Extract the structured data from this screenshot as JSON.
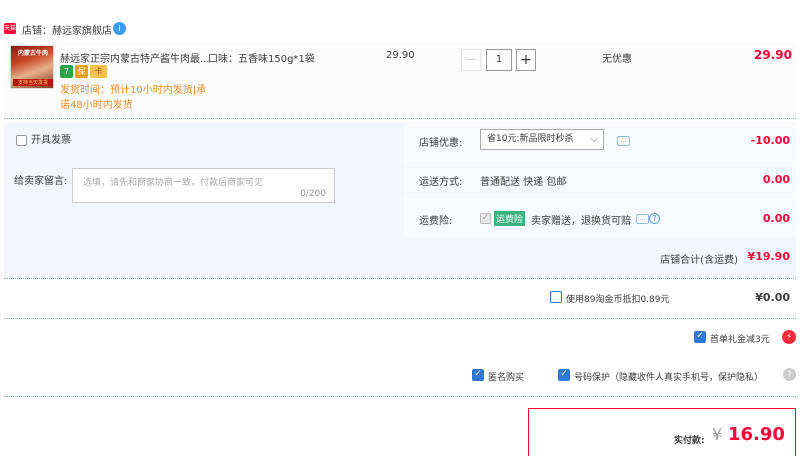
{
  "shop": {
    "icon_text": "天猫",
    "label": "店铺：赫远家旗舰店",
    "ww_icon": "i"
  },
  "item": {
    "thumb_top": "内蒙古牛肉",
    "thumb_bot": "支持当天发货",
    "title": "赫远家正宗内蒙古特产酱牛肉最...",
    "badges": [
      "7",
      "保",
      "卡"
    ],
    "ship_line1": "发货时间：预计10小时内发货|承",
    "ship_line2": "诺48小时内发货",
    "flavor": "口味：五香味150g*1袋",
    "unit_price": "29.90",
    "qty_minus": "−",
    "quantity": "1",
    "qty_plus": "+",
    "discount": "无优惠",
    "total": "29.90"
  },
  "options": {
    "invoice_label": "开具发票",
    "message_label": "给卖家留言:",
    "message_placeholder": "选填，请先和商家协商一致，付款后商家可见",
    "message_count": "0/200",
    "shop_discount_label": "店铺优惠:",
    "shop_discount_selected": "省10元:新品限时秒杀",
    "shop_discount_amount": "-10.00",
    "delivery_label": "运送方式:",
    "delivery_value": "普通配送 快递 包邮",
    "delivery_amount": "0.00",
    "insurance_label": "运费险:",
    "insurance_tag": "运费险",
    "insurance_text": "卖家赠送，退换货可赔",
    "insurance_amount": "0.00",
    "store_total_label": "店铺合计(含运费)",
    "store_total_amount": "¥19.90"
  },
  "coins": {
    "label": "使用89淘金币抵扣0.89元",
    "amount": "¥0.00"
  },
  "first_order": {
    "label": "首单礼金减3元",
    "icon": "⚡"
  },
  "privacy": {
    "anonymous_label": "匿名购买",
    "number_protect_label": "号码保护（隐藏收件人真实手机号，保护隐私）",
    "help_icon": "?"
  },
  "payment": {
    "label": "实付款:",
    "currency": "¥",
    "amount": "16.90"
  },
  "colors": {
    "accent": "#ff0036",
    "panel_bg": "#f2f7ff",
    "ship_orange": "#f08a24",
    "check_blue": "#2f78d6"
  }
}
